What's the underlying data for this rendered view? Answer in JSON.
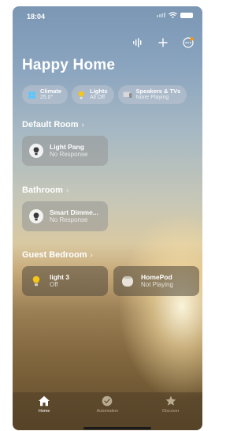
{
  "status_bar": {
    "time": "18:04"
  },
  "home": {
    "title": "Happy Home"
  },
  "chips": [
    {
      "label": "Climate",
      "sub": "25.0°",
      "icon": "fan-icon"
    },
    {
      "label": "Lights",
      "sub": "All Off",
      "icon": "lightbulb-icon"
    },
    {
      "label": "Speakers & TVs",
      "sub": "None Playing",
      "icon": "tv-icon"
    }
  ],
  "rooms": [
    {
      "name": "Default Room",
      "accessories": [
        {
          "name": "Light Pang",
          "status": "No Response"
        }
      ]
    },
    {
      "name": "Bathroom",
      "accessories": [
        {
          "name": "Smart Dimme...",
          "status": "No Response"
        }
      ]
    },
    {
      "name": "Guest Bedroom",
      "accessories": [
        {
          "name": "light 3",
          "status": "Off"
        },
        {
          "name": "HomePod",
          "status": "Not Playing"
        }
      ]
    }
  ],
  "tabs": [
    {
      "label": "Home",
      "icon": "house-icon",
      "active": true
    },
    {
      "label": "Automation",
      "icon": "clock-check-icon",
      "active": false
    },
    {
      "label": "Discover",
      "icon": "star-icon",
      "active": false
    }
  ],
  "colors": {
    "active_tab": "#ffffff",
    "inactive_tab": "#b9ab92",
    "bulb_on": "#f5c518"
  }
}
